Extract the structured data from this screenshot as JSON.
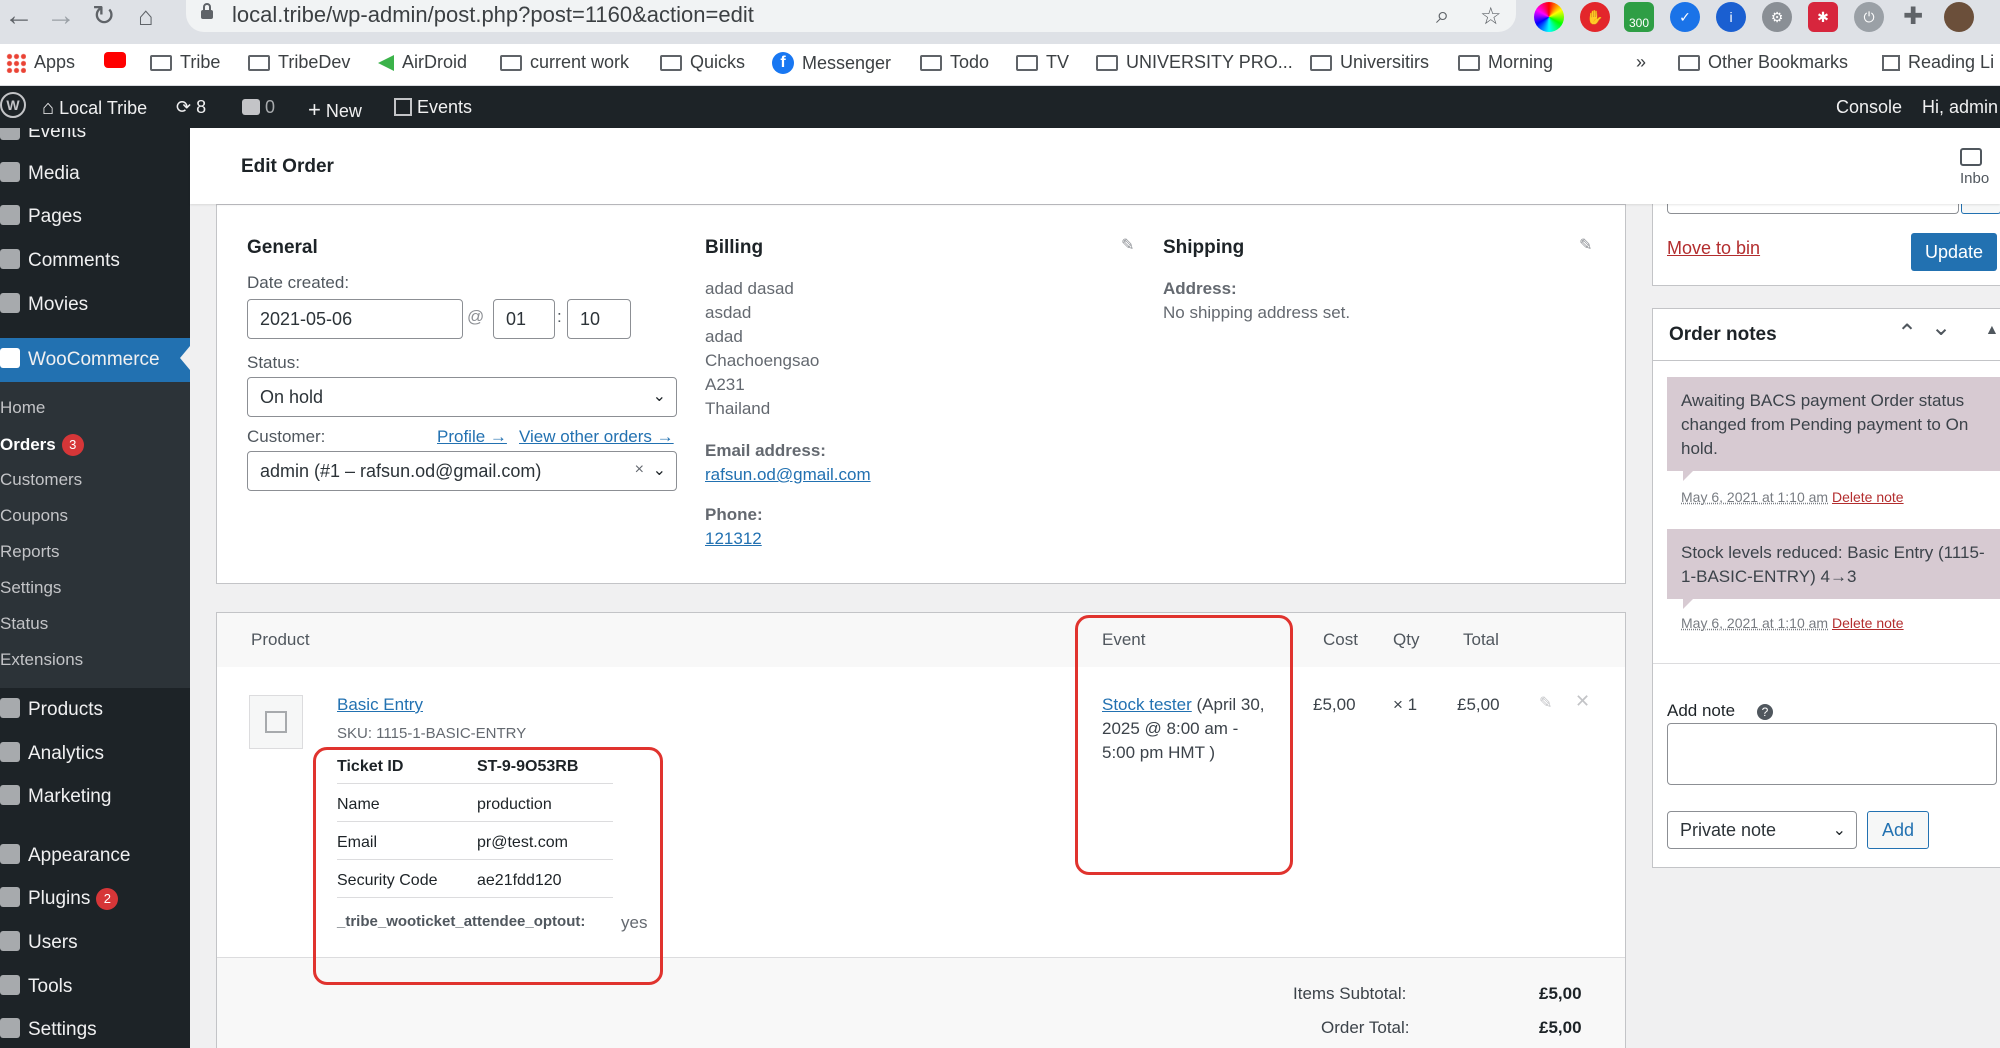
{
  "browser": {
    "url": "local.tribe/wp-admin/post.php?post=1160&action=edit",
    "ext_badge": "300",
    "bookmarks": [
      "Apps",
      "Tribe",
      "TribeDev",
      "AirDroid",
      "current work",
      "Quicks",
      "Messenger",
      "Todo",
      "TV",
      "UNIVERSITY PRO...",
      "Universitirs",
      "Morning"
    ],
    "more": "»",
    "other_bookmarks": "Other Bookmarks",
    "reading_list": "Reading Li"
  },
  "adminbar": {
    "site": "Local Tribe",
    "updates": "8",
    "comments": "0",
    "new": "New",
    "events": "Events",
    "console": "Console",
    "greeting": "Hi, admin"
  },
  "sidebar": {
    "items": [
      {
        "label": "Events"
      },
      {
        "label": "Media"
      },
      {
        "label": "Pages"
      },
      {
        "label": "Comments"
      },
      {
        "label": "Movies"
      },
      {
        "label": "WooCommerce"
      },
      {
        "label": "Products"
      },
      {
        "label": "Analytics"
      },
      {
        "label": "Marketing"
      },
      {
        "label": "Appearance"
      },
      {
        "label": "Plugins",
        "badge": "2"
      },
      {
        "label": "Users"
      },
      {
        "label": "Tools"
      },
      {
        "label": "Settings"
      }
    ],
    "submenu": [
      {
        "label": "Home"
      },
      {
        "label": "Orders",
        "badge": "3"
      },
      {
        "label": "Customers"
      },
      {
        "label": "Coupons"
      },
      {
        "label": "Reports"
      },
      {
        "label": "Settings"
      },
      {
        "label": "Status"
      },
      {
        "label": "Extensions"
      }
    ]
  },
  "header": {
    "title": "Edit Order",
    "inbox": "Inbo"
  },
  "general": {
    "heading": "General",
    "date_label": "Date created:",
    "date": "2021-05-06",
    "at": "@",
    "hour": "01",
    "colon": ":",
    "minute": "10",
    "status_label": "Status:",
    "status": "On hold",
    "customer_label": "Customer:",
    "profile_link": "Profile →",
    "other_orders_link": "View other orders →",
    "customer": "admin (#1 – rafsun.od@gmail.com)",
    "clear": "×"
  },
  "billing": {
    "heading": "Billing",
    "address": [
      "adad dasad",
      "asdad",
      "adad",
      "Chachoengsao",
      "A231",
      "Thailand"
    ],
    "email_label": "Email address:",
    "email": "rafsun.od@gmail.com",
    "phone_label": "Phone:",
    "phone": "121312"
  },
  "shipping": {
    "heading": "Shipping",
    "address_label": "Address:",
    "address": "No shipping address set."
  },
  "items": {
    "headers": {
      "product": "Product",
      "event": "Event",
      "cost": "Cost",
      "qty": "Qty",
      "total": "Total"
    },
    "row": {
      "name": "Basic Entry",
      "sku": "SKU: 1115-1-BASIC-ENTRY",
      "event_link": "Stock tester",
      "event_rest_1": " (April 30,",
      "event_rest_2": "2025 @ 8:00 am -",
      "event_rest_3": "5:00 pm HMT )",
      "cost": "£5,00",
      "qty": "× 1",
      "total": "£5,00",
      "meta": [
        {
          "key": "Ticket ID",
          "value": "ST-9-9O53RB"
        },
        {
          "key": "Name",
          "value": "production"
        },
        {
          "key": "Email",
          "value": "pr@test.com"
        },
        {
          "key": "Security Code",
          "value": "ae21fdd120"
        }
      ],
      "optout_key": "_tribe_wooticket_attendee_optout:",
      "optout_value": "yes"
    },
    "subtotal_label": "Items Subtotal:",
    "subtotal": "£5,00",
    "order_total_label": "Order Total:",
    "order_total": "£5,00"
  },
  "actions": {
    "move_to_bin": "Move to bin",
    "update": "Update"
  },
  "notes": {
    "heading": "Order notes",
    "list": [
      {
        "text": "Awaiting BACS payment Order status changed from Pending payment to On hold.",
        "date": "May 6, 2021 at 1:10 am",
        "delete": "Delete note"
      },
      {
        "text": "Stock levels reduced: Basic Entry (1115-1-BASIC-ENTRY) 4→3",
        "date": "May 6, 2021 at 1:10 am",
        "delete": "Delete note"
      }
    ],
    "add_label": "Add note",
    "help": "?",
    "type": "Private note",
    "add_button": "Add"
  },
  "colors": {
    "accent": "#2271b1",
    "admin_bg": "#1d2327",
    "highlight": "#e0332e",
    "note_bg": "#d7cad2"
  }
}
